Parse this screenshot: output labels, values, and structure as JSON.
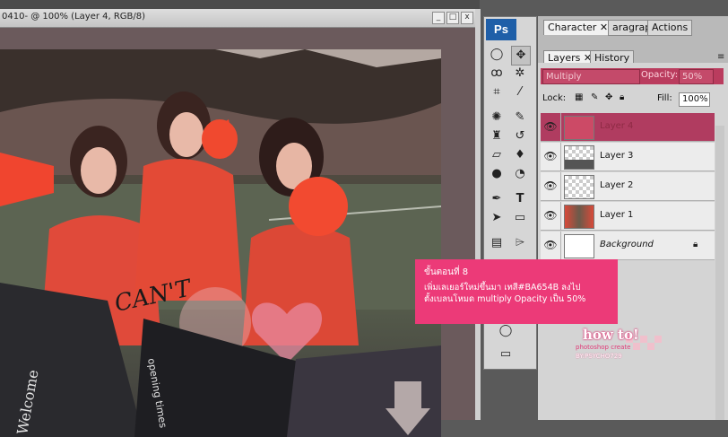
{
  "document": {
    "title": "0410- @ 100% (Layer 4, RGB/8)",
    "controls": {
      "minimize": "_",
      "maximize": "□",
      "close": "x"
    }
  },
  "image_text": {
    "cant": "CAN'T",
    "welcome": "Welcome",
    "opening_times": "opening times"
  },
  "toolbox": {
    "logo": "Ps"
  },
  "panels": {
    "top_tabs": [
      "Character",
      "aragraph",
      "Actions"
    ],
    "layer_tabs": [
      "Layers",
      "History"
    ],
    "blend_mode": "Multiply",
    "opacity_label": "Opacity:",
    "opacity_value": "50%",
    "lock_label": "Lock:",
    "fill_label": "Fill:",
    "fill_value": "100%",
    "layers": [
      {
        "name": "Layer 4",
        "selected": true,
        "thumb_color": "#cc4a66"
      },
      {
        "name": "Layer 3",
        "selected": false
      },
      {
        "name": "Layer 2",
        "selected": false
      },
      {
        "name": "Layer 1",
        "selected": false
      },
      {
        "name": "Background",
        "selected": false,
        "locked": true
      }
    ]
  },
  "callout": {
    "title": "ขั้นตอนที่ 8",
    "line1": "เพิ่มเลเยอร์ใหม่ขึ้นมา เทสี#BA654B ลงไป",
    "line2": "ตั้งเบลนโหมด multiply Opacity เป็น 50%",
    "color": "#ec3a78"
  },
  "watermark": {
    "line1": "how to!",
    "line2": "photoshop create",
    "line3": "BY:PSYCHO729"
  }
}
